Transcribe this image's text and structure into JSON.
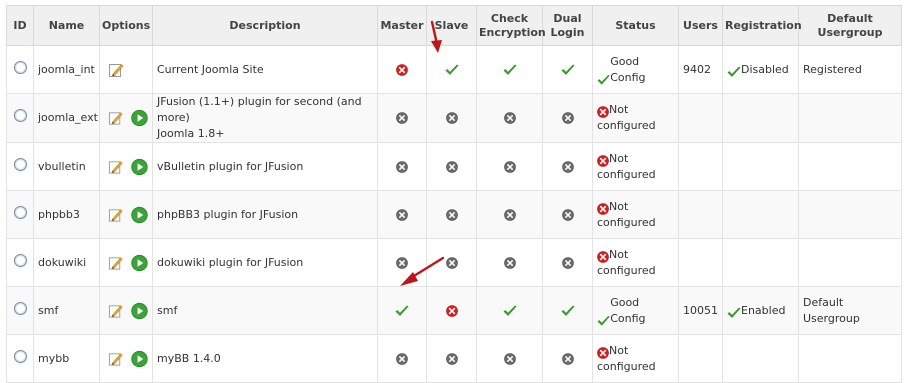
{
  "columns": {
    "id": "ID",
    "name": "Name",
    "options": "Options",
    "description": "Description",
    "master": "Master",
    "slave": "Slave",
    "check_enc_1": "Check",
    "check_enc_2": "Encryption",
    "dual_1": "Dual",
    "dual_2": "Login",
    "status": "Status",
    "users": "Users",
    "registration": "Registration",
    "usergroup_1": "Default",
    "usergroup_2": "Usergroup"
  },
  "rows": [
    {
      "name": "joomla_int",
      "desc1": "Current Joomla Site",
      "desc2": "",
      "status1": "Good Config",
      "status2": "",
      "users": "9402",
      "registration": "Disabled",
      "ug1": "Registered",
      "ug2": ""
    },
    {
      "name": "joomla_ext",
      "desc1": "JFusion (1.1+) plugin for second (and more)",
      "desc2": "Joomla 1.8+",
      "status1": "Not",
      "status2": "configured",
      "users": "",
      "registration": "",
      "ug1": "",
      "ug2": ""
    },
    {
      "name": "vbulletin",
      "desc1": "vBulletin plugin for JFusion",
      "desc2": "",
      "status1": "Not",
      "status2": "configured",
      "users": "",
      "registration": "",
      "ug1": "",
      "ug2": ""
    },
    {
      "name": "phpbb3",
      "desc1": "phpBB3 plugin for JFusion",
      "desc2": "",
      "status1": "Not",
      "status2": "configured",
      "users": "",
      "registration": "",
      "ug1": "",
      "ug2": ""
    },
    {
      "name": "dokuwiki",
      "desc1": "dokuwiki plugin for JFusion",
      "desc2": "",
      "status1": "Not",
      "status2": "configured",
      "users": "",
      "registration": "",
      "ug1": "",
      "ug2": ""
    },
    {
      "name": "smf",
      "desc1": "smf",
      "desc2": "",
      "status1": "Good Config",
      "status2": "",
      "users": "10051",
      "registration": "Enabled",
      "ug1": "Default",
      "ug2": "Usergroup"
    },
    {
      "name": "mybb",
      "desc1": "myBB 1.4.0",
      "desc2": "",
      "status1": "Not",
      "status2": "configured",
      "users": "",
      "registration": "",
      "ug1": "",
      "ug2": ""
    }
  ],
  "colors": {
    "check": "#3daa2b",
    "error": "#d42020",
    "disabled": "#6b6b6b",
    "arrow": "#c0141a",
    "play": "#3aa537"
  }
}
